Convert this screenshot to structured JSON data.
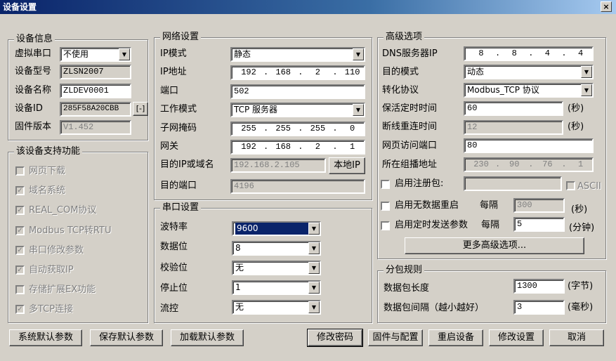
{
  "window": {
    "title": "设备设置",
    "close": "×"
  },
  "device_info": {
    "legend": "设备信息",
    "virtual_port_label": "虚拟串口",
    "virtual_port_value": "不使用",
    "model_label": "设备型号",
    "model_value": "ZLSN2007",
    "name_label": "设备名称",
    "name_value": "ZLDEV0001",
    "id_label": "设备ID",
    "id_value": "285F58A20CBB",
    "id_button": "[-]",
    "firmware_label": "固件版本",
    "firmware_value": "V1.452"
  },
  "features": {
    "legend": "该设备支持功能",
    "items": [
      {
        "label": "网页下载",
        "checked": false
      },
      {
        "label": "域名系统",
        "checked": true
      },
      {
        "label": "REAL_COM协议",
        "checked": true
      },
      {
        "label": "Modbus TCP转RTU",
        "checked": true
      },
      {
        "label": "串口修改参数",
        "checked": true
      },
      {
        "label": "自动获取IP",
        "checked": true
      },
      {
        "label": "存储扩展EX功能",
        "checked": false
      },
      {
        "label": "多TCP连接",
        "checked": true
      }
    ]
  },
  "network": {
    "legend": "网络设置",
    "ip_mode_label": "IP模式",
    "ip_mode_value": "静态",
    "ip_addr_label": "IP地址",
    "ip_addr": [
      "192",
      "168",
      "2",
      "110"
    ],
    "port_label": "端口",
    "port_value": "502",
    "work_mode_label": "工作模式",
    "work_mode_value": "TCP 服务器",
    "mask_label": "子网掩码",
    "mask": [
      "255",
      "255",
      "255",
      "0"
    ],
    "gateway_label": "网关",
    "gateway": [
      "192",
      "168",
      "2",
      "1"
    ],
    "dest_ip_label": "目的IP或域名",
    "dest_ip_value": "192.168.2.105",
    "local_ip_button": "本地IP",
    "dest_port_label": "目的端口",
    "dest_port_value": "4196"
  },
  "serial": {
    "legend": "串口设置",
    "baud_label": "波特率",
    "baud_value": "9600",
    "databits_label": "数据位",
    "databits_value": "8",
    "parity_label": "校验位",
    "parity_value": "无",
    "stopbits_label": "停止位",
    "stopbits_value": "1",
    "flow_label": "流控",
    "flow_value": "无"
  },
  "advanced": {
    "legend": "高级选项",
    "dns_label": "DNS服务器IP",
    "dns": [
      "8",
      "8",
      "4",
      "4"
    ],
    "dest_mode_label": "目的模式",
    "dest_mode_value": "动态",
    "protocol_label": "转化协议",
    "protocol_value": "Modbus_TCP 协议",
    "keepalive_label": "保活定时时间",
    "keepalive_value": "60",
    "keepalive_unit": "(秒)",
    "reconnect_label": "断线重连时间",
    "reconnect_value": "12",
    "reconnect_unit": "(秒)",
    "web_port_label": "网页访问端口",
    "web_port_value": "80",
    "multicast_label": "所在组播地址",
    "multicast": [
      "230",
      "90",
      "76",
      "1"
    ],
    "register_label": "启用注册包:",
    "register_value": "",
    "ascii_label": "ASCII",
    "nodata_restart_label": "启用无数据重启",
    "nodata_every": "每隔",
    "nodata_value": "300",
    "nodata_unit": "(秒)",
    "timed_send_label": "启用定时发送参数",
    "timed_every": "每隔",
    "timed_value": "5",
    "timed_unit": "(分钟)",
    "more_button": "更多高级选项..."
  },
  "packet": {
    "legend": "分包规则",
    "length_label": "数据包长度",
    "length_value": "1300",
    "length_unit": "(字节)",
    "interval_label": "数据包间隔（越小越好）",
    "interval_value": "3",
    "interval_unit": "(毫秒)"
  },
  "buttons": {
    "sys_default": "系统默认参数",
    "save_default": "保存默认参数",
    "load_default": "加载默认参数",
    "change_password": "修改密码",
    "firmware_config": "固件与配置",
    "restart": "重启设备",
    "modify": "修改设置",
    "cancel": "取消"
  }
}
